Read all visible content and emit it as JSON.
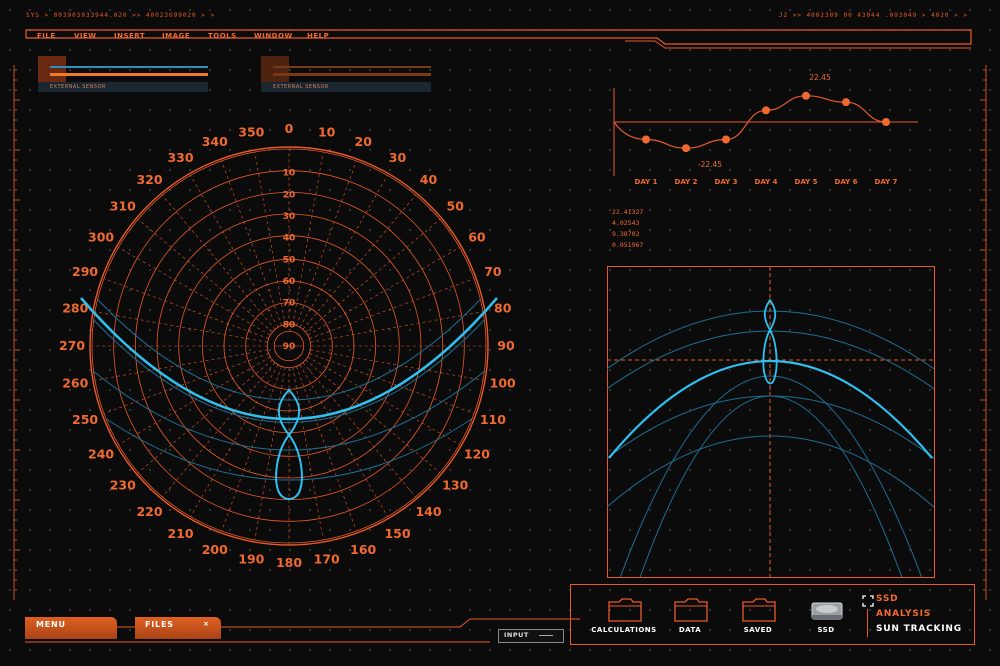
{
  "header": {
    "sys_left": "SYS > 003903033944.020 >> 40023099020 > >",
    "sys_right": "J2 >> 4002309 00 43044  .093049  > 4020 > >"
  },
  "menu": {
    "items": [
      "FILE",
      "VIEW",
      "INSERT",
      "IMAGE",
      "TOOLS",
      "WINDOW",
      "HELP"
    ]
  },
  "sensors": [
    {
      "label": "EXTERNAL SENSOR"
    },
    {
      "label": "EXTERNAL SENSOR"
    }
  ],
  "polar": {
    "azimuth_labels": [
      "0",
      "10",
      "20",
      "30",
      "40",
      "50",
      "60",
      "70",
      "80",
      "90",
      "100",
      "110",
      "120",
      "130",
      "140",
      "150",
      "160",
      "170",
      "180",
      "190",
      "200",
      "210",
      "220",
      "230",
      "240",
      "250",
      "260",
      "270",
      "280",
      "290",
      "300",
      "310",
      "320",
      "330",
      "340",
      "350"
    ],
    "elevation_labels": [
      "10",
      "20",
      "30",
      "40",
      "50",
      "60",
      "70",
      "80",
      "90"
    ]
  },
  "chart_data": {
    "type": "line",
    "categories": [
      "DAY 1",
      "DAY 2",
      "DAY 3",
      "DAY 4",
      "DAY 5",
      "DAY 6",
      "DAY 7"
    ],
    "values": [
      -15,
      -22.45,
      -15,
      10,
      22.45,
      17,
      0
    ],
    "data_labels": [
      "22.45",
      "-22.45"
    ],
    "ylim": [
      -30,
      30
    ]
  },
  "readouts": [
    "22.41327",
    "4.02543",
    "9.38702",
    "0.051967"
  ],
  "bottom": {
    "menu_tab": "MENU",
    "files_tab": "FILES",
    "files_close": "×",
    "input_label": "INPUT"
  },
  "toolbar": {
    "folders": [
      "CALCULATIONS",
      "DATA",
      "SAVED"
    ],
    "ssd_label": "SSD",
    "side_items": [
      "SSD",
      "ANALYSIS",
      "SUN TRACKING"
    ]
  },
  "colors": {
    "accent": "#e85a2a",
    "cyan": "#27b4e6",
    "background": "#0b0b0b"
  }
}
